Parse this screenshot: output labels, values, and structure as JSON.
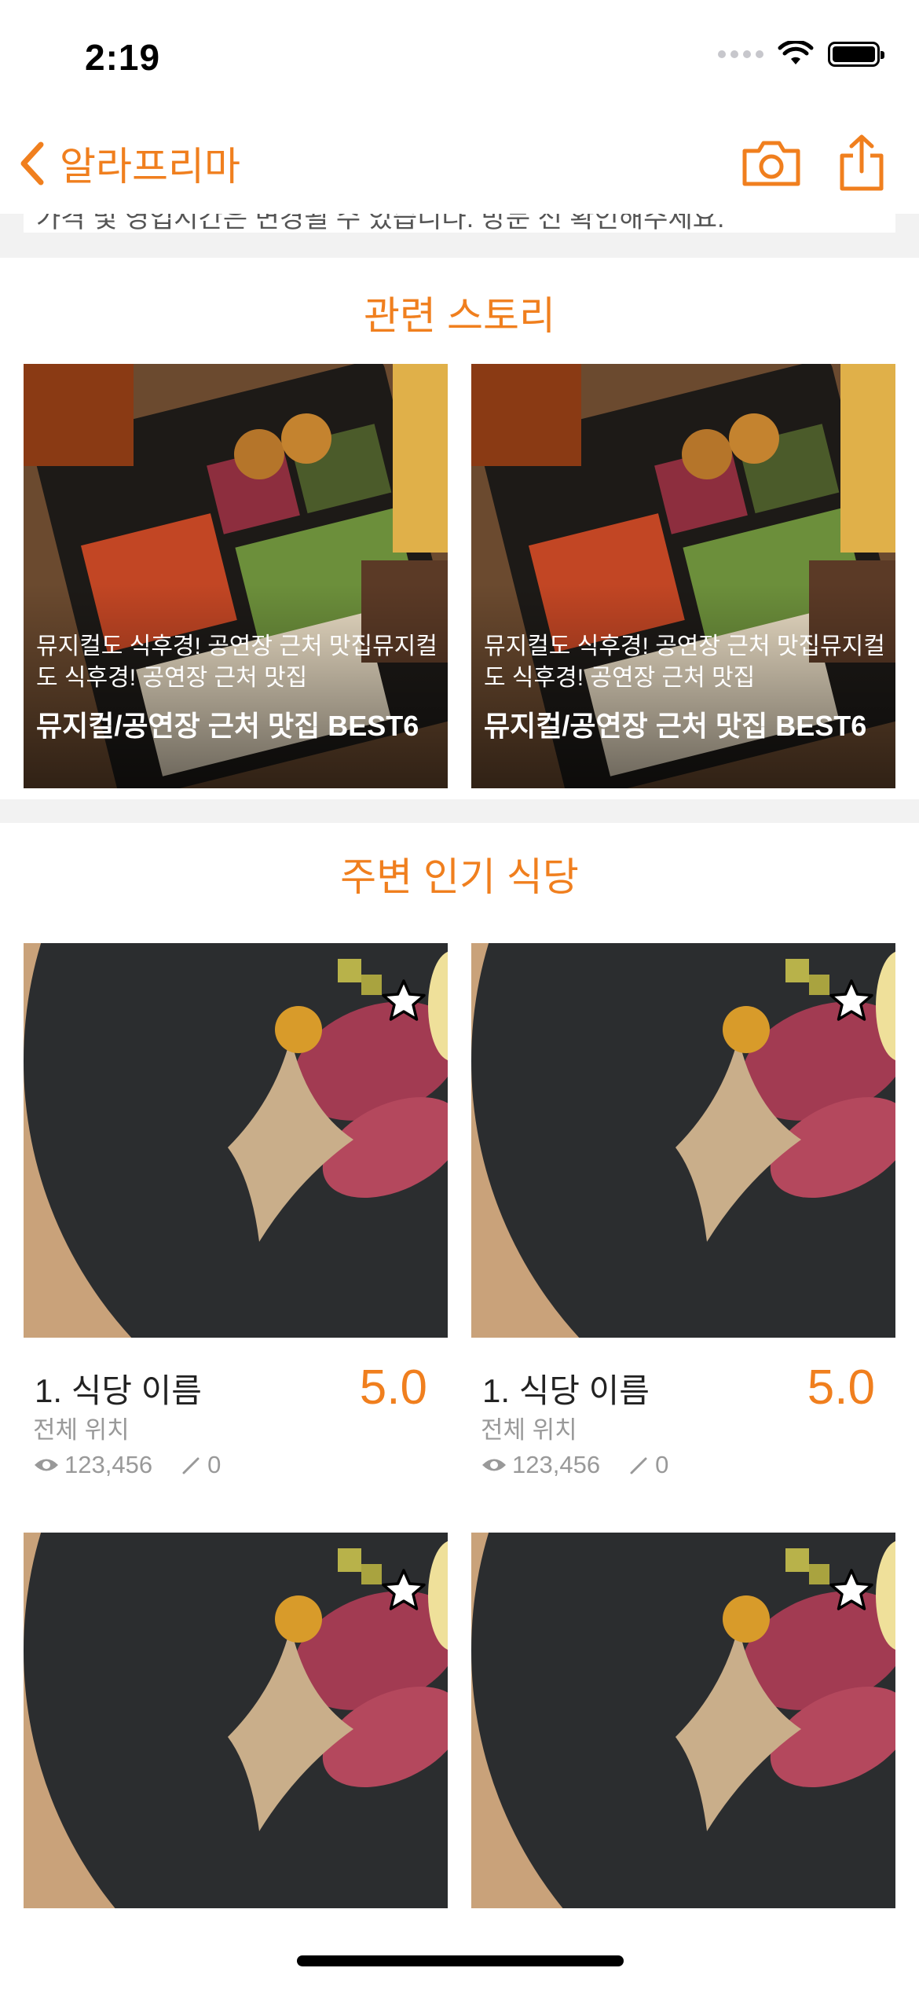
{
  "status_bar": {
    "time": "2:19"
  },
  "nav": {
    "title": "알라프리마",
    "icons": [
      "chevron-left-icon",
      "camera-icon",
      "share-icon"
    ]
  },
  "top_card": {
    "text": "가격 및 영업시간은 변경될 수 있습니다. 방문 전 확인해주세요."
  },
  "colors": {
    "accent": "#f07f1e",
    "muted": "#999999",
    "divider": "#f2f2f2"
  },
  "stories": {
    "title": "관련 스토리",
    "items": [
      {
        "desc": "뮤지컬도 식후경! 공연장 근처 맛집뮤지컬도 식후경! 공연장 근처 맛집",
        "title": "뮤지컬/공연장 근처 맛집 BEST6"
      },
      {
        "desc": "뮤지컬도 식후경! 공연장 근처 맛집뮤지컬도 식후경! 공연장 근처 맛집",
        "title": "뮤지컬/공연장 근처 맛집 BEST6"
      }
    ]
  },
  "popular": {
    "title": "주변 인기 식당",
    "items": [
      {
        "name": "1. 식당 이름",
        "score": "5.0",
        "location": "전체 위치",
        "views": "123,456",
        "reviews": "0"
      },
      {
        "name": "1. 식당 이름",
        "score": "5.0",
        "location": "전체 위치",
        "views": "123,456",
        "reviews": "0"
      },
      {
        "name": "",
        "score": "",
        "location": "",
        "views": "",
        "reviews": ""
      },
      {
        "name": "",
        "score": "",
        "location": "",
        "views": "",
        "reviews": ""
      }
    ]
  }
}
